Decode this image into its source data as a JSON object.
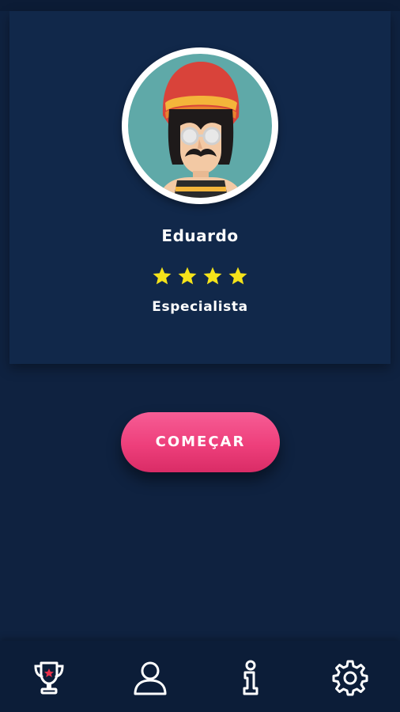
{
  "profile": {
    "name": "Eduardo",
    "rank": "Especialista",
    "stars": 4,
    "star_color": "#f5e31a"
  },
  "actions": {
    "start_label": "COMEÇAR"
  },
  "nav": {
    "items": [
      {
        "icon": "trophy-icon"
      },
      {
        "icon": "user-icon"
      },
      {
        "icon": "info-icon"
      },
      {
        "icon": "gear-icon"
      }
    ]
  },
  "colors": {
    "background": "#0f2240",
    "card": "#11284a",
    "accent": "#ee3f7b",
    "trophy_star": "#e8304a"
  }
}
